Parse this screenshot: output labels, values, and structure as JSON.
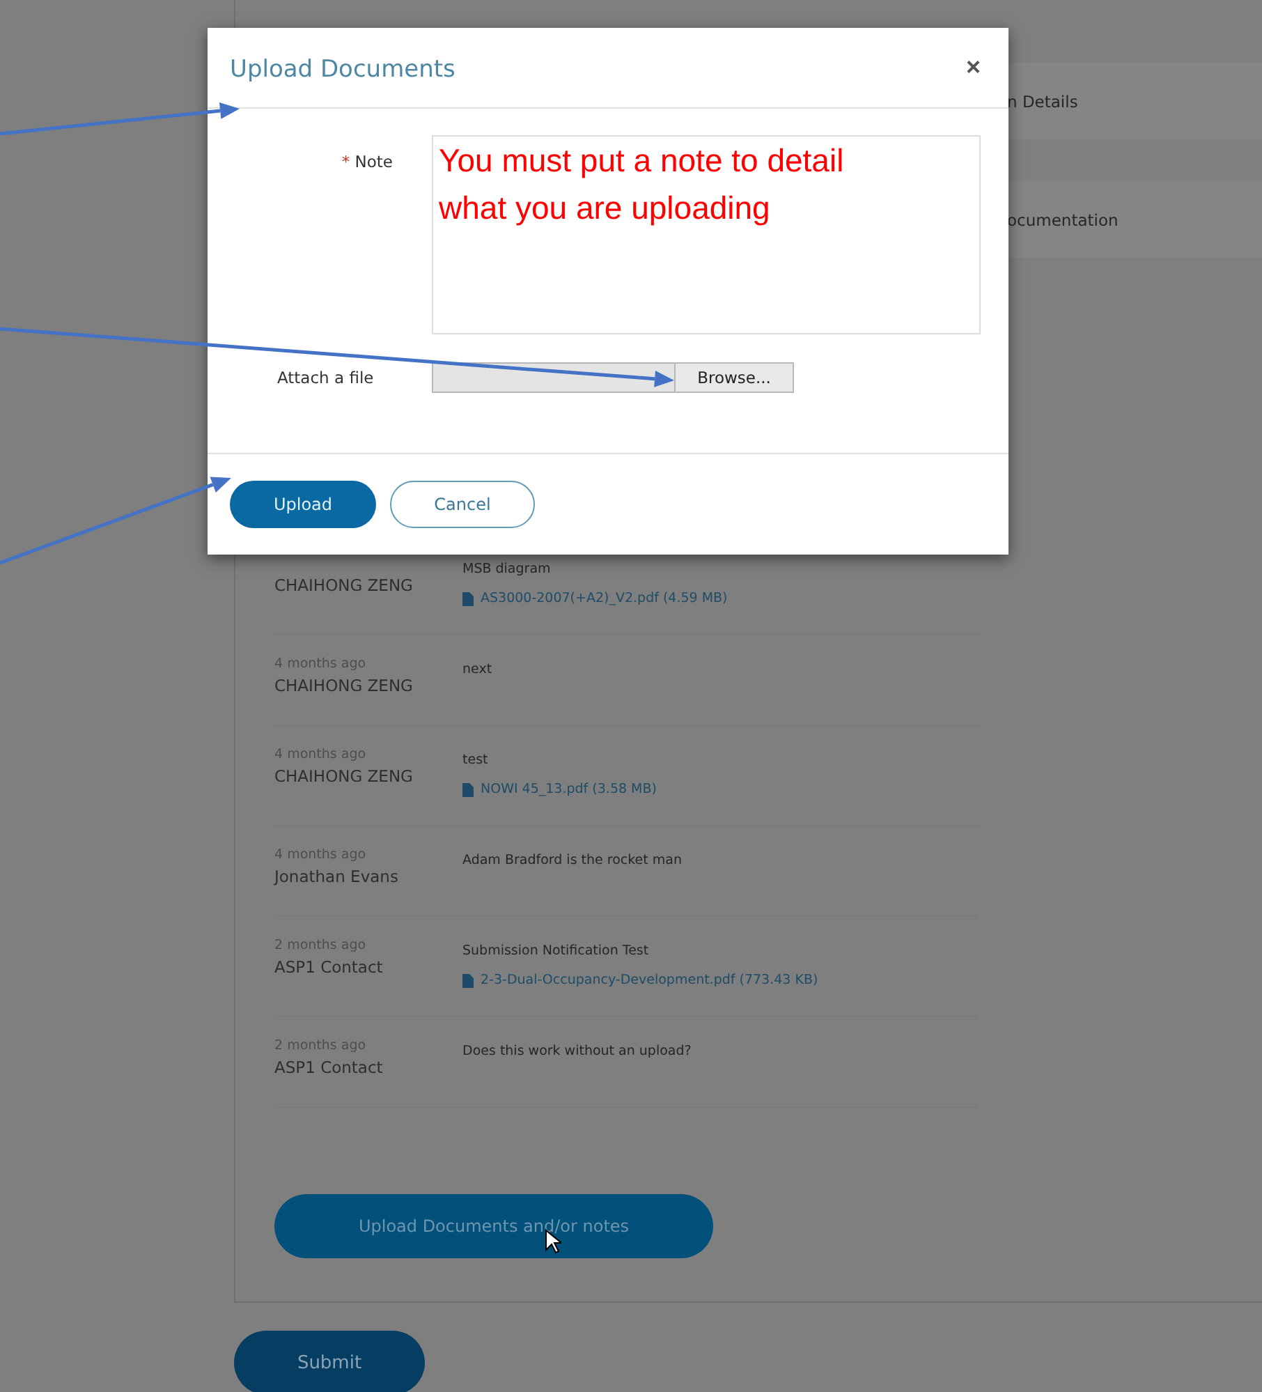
{
  "background_tabs": [
    {
      "label": "n Details"
    },
    {
      "label": "ocumentation"
    }
  ],
  "comments": [
    {
      "author": "CHAIHONG ZENG",
      "text": "MSB diagram",
      "file": "AS3000-2007(+A2)_V2.pdf (4.59 MB)"
    },
    {
      "time": "4 months ago",
      "author": "CHAIHONG ZENG",
      "text": "next"
    },
    {
      "time": "4 months ago",
      "author": "CHAIHONG ZENG",
      "text": "test",
      "file": "NOWI 45_13.pdf (3.58 MB)"
    },
    {
      "time": "4 months ago",
      "author": "Jonathan Evans",
      "text": "Adam Bradford is the rocket man"
    },
    {
      "time": "2 months ago",
      "author": "ASP1 Contact",
      "text": "Submission Notification Test",
      "file": "2-3-Dual-Occupancy-Development.pdf (773.43 KB)"
    },
    {
      "time": "2 months ago",
      "author": "ASP1 Contact",
      "text": "Does this work without an upload?"
    }
  ],
  "upload_notes_button": "Upload Documents and/or notes",
  "submit_button": "Submit",
  "modal": {
    "title": "Upload Documents",
    "close": "×",
    "note_label": "Note",
    "required_mark": "*",
    "note_annotation": "You must put a note to detail what you are uploading",
    "attach_label": "Attach a file",
    "browse_button": "Browse...",
    "upload_button": "Upload",
    "cancel_button": "Cancel"
  }
}
